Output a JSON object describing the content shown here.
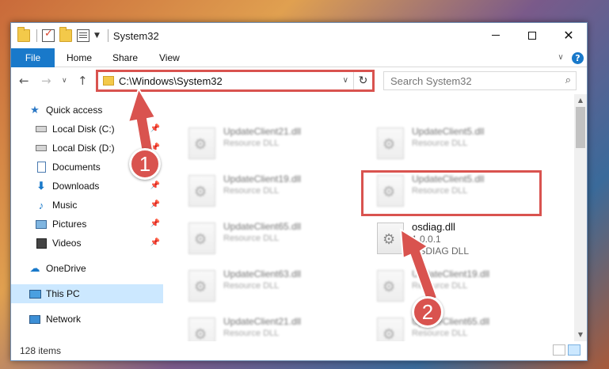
{
  "window": {
    "title": "System32",
    "minimize_label": "—",
    "maximize_label": "",
    "close_label": "✕"
  },
  "ribbon": {
    "tabs": [
      "File",
      "Home",
      "Share",
      "View"
    ],
    "help_label": "?"
  },
  "address_bar": {
    "path": "C:\\Windows\\System32",
    "refresh_symbol": "↻"
  },
  "search": {
    "placeholder": "Search System32"
  },
  "sidebar": {
    "items": [
      {
        "label": "Quick access",
        "icon": "star-icon",
        "pinned": false
      },
      {
        "label": "Local Disk (C:)",
        "icon": "disk-icon",
        "pinned": true
      },
      {
        "label": "Local Disk (D:)",
        "icon": "disk-icon",
        "pinned": true
      },
      {
        "label": "Documents",
        "icon": "document-icon",
        "pinned": true
      },
      {
        "label": "Downloads",
        "icon": "download-icon",
        "pinned": true
      },
      {
        "label": "Music",
        "icon": "music-icon",
        "pinned": true
      },
      {
        "label": "Pictures",
        "icon": "picture-icon",
        "pinned": true
      },
      {
        "label": "Videos",
        "icon": "video-icon",
        "pinned": true
      },
      {
        "label": "OneDrive",
        "icon": "cloud-icon",
        "pinned": false
      },
      {
        "label": "This PC",
        "icon": "computer-icon",
        "pinned": false,
        "selected": true
      },
      {
        "label": "Network",
        "icon": "network-icon",
        "pinned": false
      }
    ]
  },
  "files": [
    {
      "name": "UpdateClient21.dll",
      "line2": "Resource DLL",
      "line3": "",
      "blurred": true
    },
    {
      "name": "UpdateClient5.dll",
      "line2": "Resource DLL",
      "line3": "",
      "blurred": true
    },
    {
      "name": "UpdateClient19.dll",
      "line2": "Resource DLL",
      "line3": "",
      "blurred": true
    },
    {
      "name": "UpdateClient5.dll",
      "line2": "Resource DLL",
      "line3": "",
      "blurred": true
    },
    {
      "name": "UpdateClient65.dll",
      "line2": "Resource DLL",
      "line3": "",
      "blurred": true
    },
    {
      "name": "osdiag.dll",
      "line2": "1.0.0.1",
      "line3": "OSDIAG DLL",
      "blurred": false
    },
    {
      "name": "UpdateClient63.dll",
      "line2": "Resource DLL",
      "line3": "",
      "blurred": true
    },
    {
      "name": "UpdateClient19.dll",
      "line2": "Resource DLL",
      "line3": "",
      "blurred": true
    },
    {
      "name": "UpdateClient21.dll",
      "line2": "Resource DLL",
      "line3": "",
      "blurred": true
    },
    {
      "name": "UpdateClient65.dll",
      "line2": "Resource DLL",
      "line3": "",
      "blurred": true
    }
  ],
  "status": {
    "item_count": "128 items"
  },
  "annotations": {
    "step1": "1",
    "step2": "2",
    "color": "#d9534f"
  }
}
